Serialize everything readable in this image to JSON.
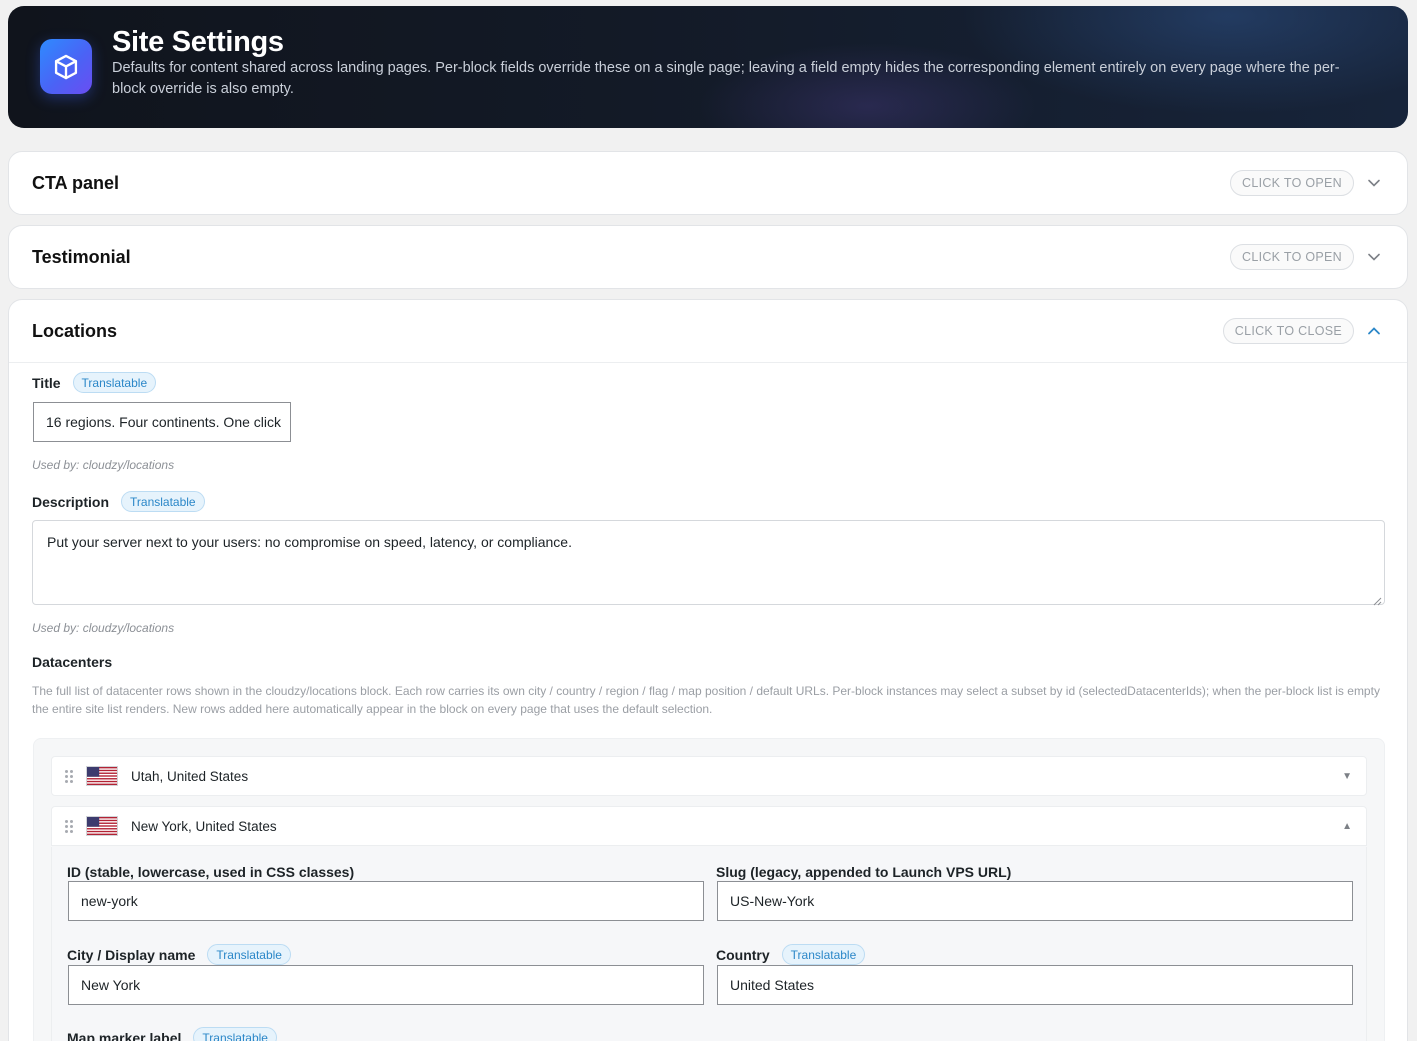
{
  "header": {
    "title": "Site Settings",
    "description": "Defaults for content shared across landing pages. Per-block fields override these on a single page; leaving a field empty hides the corresponding element entirely on every page where the per-block override is also empty."
  },
  "panels": {
    "cta": {
      "title": "CTA panel",
      "toggle": "CLICK TO OPEN"
    },
    "testimonial": {
      "title": "Testimonial",
      "toggle": "CLICK TO OPEN"
    },
    "locations": {
      "title": "Locations",
      "toggle": "CLICK TO CLOSE"
    }
  },
  "badge_label": "Translatable",
  "locations": {
    "title_label": "Title",
    "title_value": "16 regions. Four continents. One click",
    "title_used_by": "Used by: cloudzy/locations",
    "description_label": "Description",
    "description_value": "Put your server next to your users: no compromise on speed, latency, or compliance.",
    "description_used_by": "Used by: cloudzy/locations",
    "datacenters_label": "Datacenters",
    "datacenters_help": "The full list of datacenter rows shown in the cloudzy/locations block. Each row carries its own city / country / region / flag / map position / default URLs. Per-block instances may select a subset by id (selectedDatacenterIds); when the per-block list is empty the entire site list renders. New rows added here automatically appear in the block on every page that uses the default selection.",
    "rows": [
      {
        "name": "Utah, United States",
        "caret": "▼"
      },
      {
        "name": "New York, United States",
        "caret": "▲"
      }
    ],
    "expanded": {
      "id_label": "ID (stable, lowercase, used in CSS classes)",
      "id_value": "new-york",
      "slug_label": "Slug (legacy, appended to Launch VPS URL)",
      "slug_value": "US-New-York",
      "city_label": "City / Display name",
      "city_value": "New York",
      "country_label": "Country",
      "country_value": "United States",
      "marker_label": "Map marker label"
    }
  },
  "colors": {
    "accent": "#2b87c8",
    "header_bg": "#10141c",
    "logo_gradient_start": "#2e8bff",
    "logo_gradient_end": "#6a4df2"
  }
}
